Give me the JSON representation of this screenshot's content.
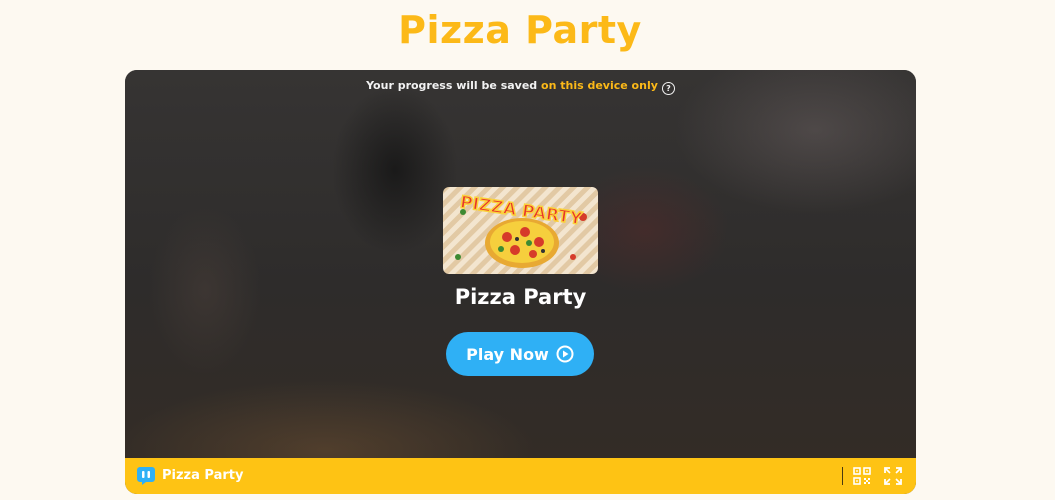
{
  "page": {
    "title": "Pizza Party"
  },
  "game": {
    "progress_prefix": "Your progress will be saved ",
    "progress_accent": "on this device only",
    "help_icon_glyph": "?",
    "thumbnail_text": "PIZZA PARTY",
    "name": "Pizza Party",
    "play_label": "Play Now"
  },
  "bottom_bar": {
    "title": "Pizza Party",
    "icons": [
      "app-logo-icon",
      "qr-code-icon",
      "fullscreen-icon"
    ]
  },
  "colors": {
    "accent": "#fcb918",
    "play_button": "#2fb0f5",
    "bar": "#fec314"
  }
}
